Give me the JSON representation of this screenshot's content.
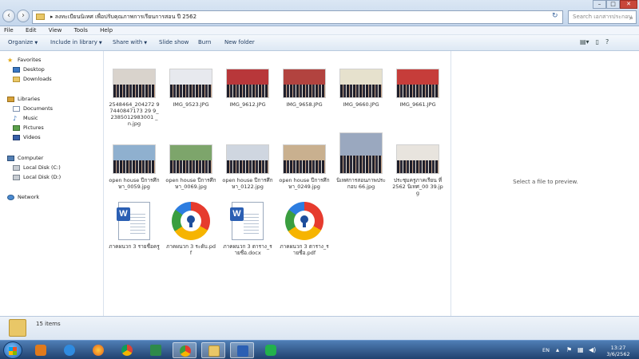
{
  "address": {
    "path": "▸ ลงทะเบียนนิเทศ เพื่อปรับคุณภาพการเรียนการสอน ปี 2562"
  },
  "search": {
    "placeholder": "Search เอกสารประกอบ"
  },
  "menu": [
    "File",
    "Edit",
    "View",
    "Tools",
    "Help"
  ],
  "toolbar": {
    "organize": "Organize",
    "include": "Include in library",
    "share": "Share with",
    "slideshow": "Slide show",
    "burn": "Burn",
    "newfolder": "New folder"
  },
  "nav": {
    "favorites": "Favorites",
    "desktop": "Desktop",
    "downloads": "Downloads",
    "libraries": "Libraries",
    "documents": "Documents",
    "music": "Music",
    "pictures": "Pictures",
    "videos": "Videos",
    "computer": "Computer",
    "local_c": "Local Disk (C:)",
    "local_d": "Local Disk (D:)",
    "network": "Network"
  },
  "files": [
    {
      "label": "2548464_204272 97440847173 29 9_2385012983001 _n.jpg",
      "kind": "photo",
      "sky": "#d9d3cc"
    },
    {
      "label": "IMG_9523.JPG",
      "kind": "photo",
      "sky": "#e7e9ee"
    },
    {
      "label": "IMG_9612.JPG",
      "kind": "photo",
      "sky": "#b8373a"
    },
    {
      "label": "IMG_9658.JPG",
      "kind": "photo",
      "sky": "#b2433f"
    },
    {
      "label": "IMG_9660.JPG",
      "kind": "photo",
      "sky": "#e6e1cd"
    },
    {
      "label": "IMG_9661.JPG",
      "kind": "photo",
      "sky": "#c63d3a"
    },
    {
      "label": "open house ปีการศึกษา_0059.jpg",
      "kind": "photo",
      "sky": "#8fb0cf"
    },
    {
      "label": "open house ปีการศึกษา_0069.jpg",
      "kind": "photo",
      "sky": "#7da56b"
    },
    {
      "label": "open house ปีการศึกษา_0122.jpg",
      "kind": "photo",
      "sky": "#cfd6e0"
    },
    {
      "label": "open house ปีการศึกษา_0249.jpg",
      "kind": "photo",
      "sky": "#c9b08f"
    },
    {
      "label": "นิเทศการสอนภาพประกอบ 66.jpg",
      "kind": "photo",
      "sky": "#9aa8bf"
    },
    {
      "label": "ประชุมครูภาคเรียน ที่ 2562 นิเทศ_00 39.jpg",
      "kind": "photo",
      "sky": "#e8e4de"
    },
    {
      "label": "ภาคผนวก 3 รายชื่อครู",
      "kind": "doc"
    },
    {
      "label": "ภาคผนวก 3 ระดับ.pdf",
      "kind": "pdf"
    },
    {
      "label": "ภาคผนวก 3 ตาราง_รายชื่อ.docx",
      "kind": "doc"
    },
    {
      "label": "ภาคผนวก 3 ตาราง_รายชื่อ.pdf",
      "kind": "pdf"
    }
  ],
  "preview": {
    "message": "Select a file to preview."
  },
  "status": {
    "count": "15 items"
  },
  "tray": {
    "lang": "EN",
    "time": "13:27",
    "date": "3/6/2562"
  },
  "colors": {
    "address_bar": "#c4d6ec",
    "taskbar": "#20426f",
    "command_bar": "#dde8f4"
  }
}
